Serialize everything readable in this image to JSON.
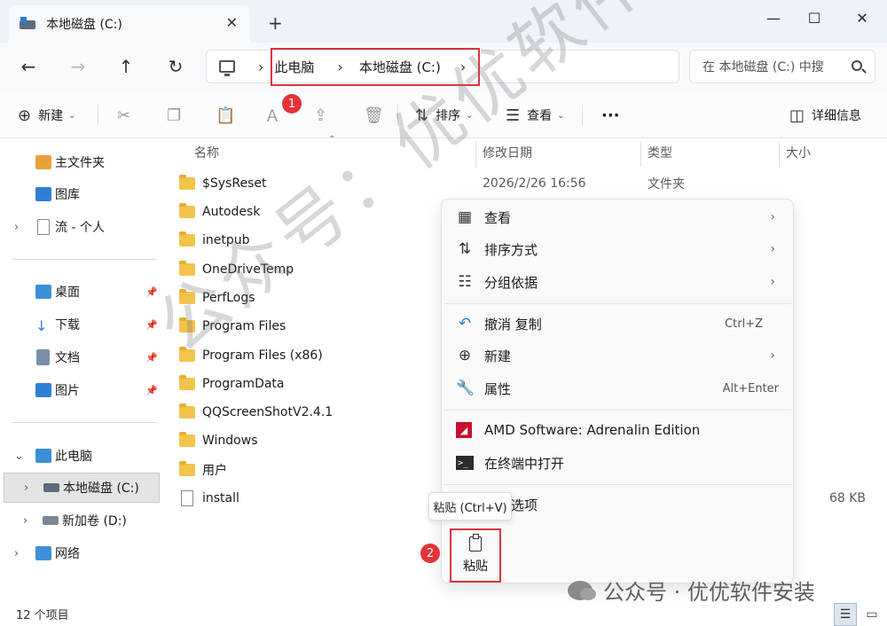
{
  "window": {
    "tab_title": "本地磁盘 (C:)",
    "tab_close": "✕",
    "new_tab": "+",
    "minimize": "—",
    "maximize": "☐",
    "close": "✕"
  },
  "nav": {
    "back": "←",
    "forward": "→",
    "up": "↑",
    "refresh": "↻",
    "breadcrumb": [
      "此电脑",
      "本地磁盘 (C:)"
    ],
    "sep": "›",
    "search_placeholder": "在 本地磁盘 (C:) 中搜"
  },
  "toolbar": {
    "new_label": "新建",
    "sort_label": "排序",
    "view_label": "查看",
    "more": "···",
    "details_label": "详细信息",
    "badge1": "1"
  },
  "sidebar": {
    "items": [
      {
        "label": "主文件夹"
      },
      {
        "label": "图库"
      },
      {
        "label": "流 - 个人"
      },
      {
        "label": "桌面"
      },
      {
        "label": "下载"
      },
      {
        "label": "文档"
      },
      {
        "label": "图片"
      },
      {
        "label": "此电脑"
      },
      {
        "label": "本地磁盘 (C:)"
      },
      {
        "label": "新加卷 (D:)"
      },
      {
        "label": "网络"
      }
    ]
  },
  "columns": {
    "name": "名称",
    "date": "修改日期",
    "type": "类型",
    "size": "大小"
  },
  "files": [
    {
      "name": "$SysReset",
      "date": "2026/2/26 16:56",
      "type": "文件夹",
      "size": ""
    },
    {
      "name": "Autodesk",
      "date": "",
      "type": "",
      "size": ""
    },
    {
      "name": "inetpub",
      "date": "",
      "type": "",
      "size": ""
    },
    {
      "name": "OneDriveTemp",
      "date": "",
      "type": "",
      "size": ""
    },
    {
      "name": "PerfLogs",
      "date": "",
      "type": "",
      "size": ""
    },
    {
      "name": "Program Files",
      "date": "",
      "type": "",
      "size": ""
    },
    {
      "name": "Program Files (x86)",
      "date": "",
      "type": "",
      "size": ""
    },
    {
      "name": "ProgramData",
      "date": "",
      "type": "",
      "size": ""
    },
    {
      "name": "QQScreenShotV2.4.1",
      "date": "",
      "type": "",
      "size": ""
    },
    {
      "name": "Windows",
      "date": "",
      "type": "",
      "size": ""
    },
    {
      "name": "用户",
      "date": "",
      "type": "",
      "size": ""
    },
    {
      "name": "install",
      "date": "",
      "type": "",
      "size": "68 KB"
    }
  ],
  "context_menu": {
    "view": "查看",
    "sort": "排序方式",
    "group": "分组依据",
    "undo": "撤消 复制",
    "undo_shortcut": "Ctrl+Z",
    "new": "新建",
    "properties": "属性",
    "properties_shortcut": "Alt+Enter",
    "amd": "AMD Software: Adrenalin Edition",
    "terminal": "在终端中打开",
    "more_options": "更多选项",
    "arrow": "›",
    "paste_tooltip": "粘贴 (Ctrl+V)",
    "paste_label": "粘贴",
    "badge2": "2"
  },
  "status": {
    "count": "12 个项目"
  },
  "watermark": {
    "diagonal": "公众号：优优软件安装",
    "bottom": "公众号 · 优优软件安装"
  },
  "colors": {
    "accent": "#d9363e",
    "folder": "#f3c44b"
  }
}
